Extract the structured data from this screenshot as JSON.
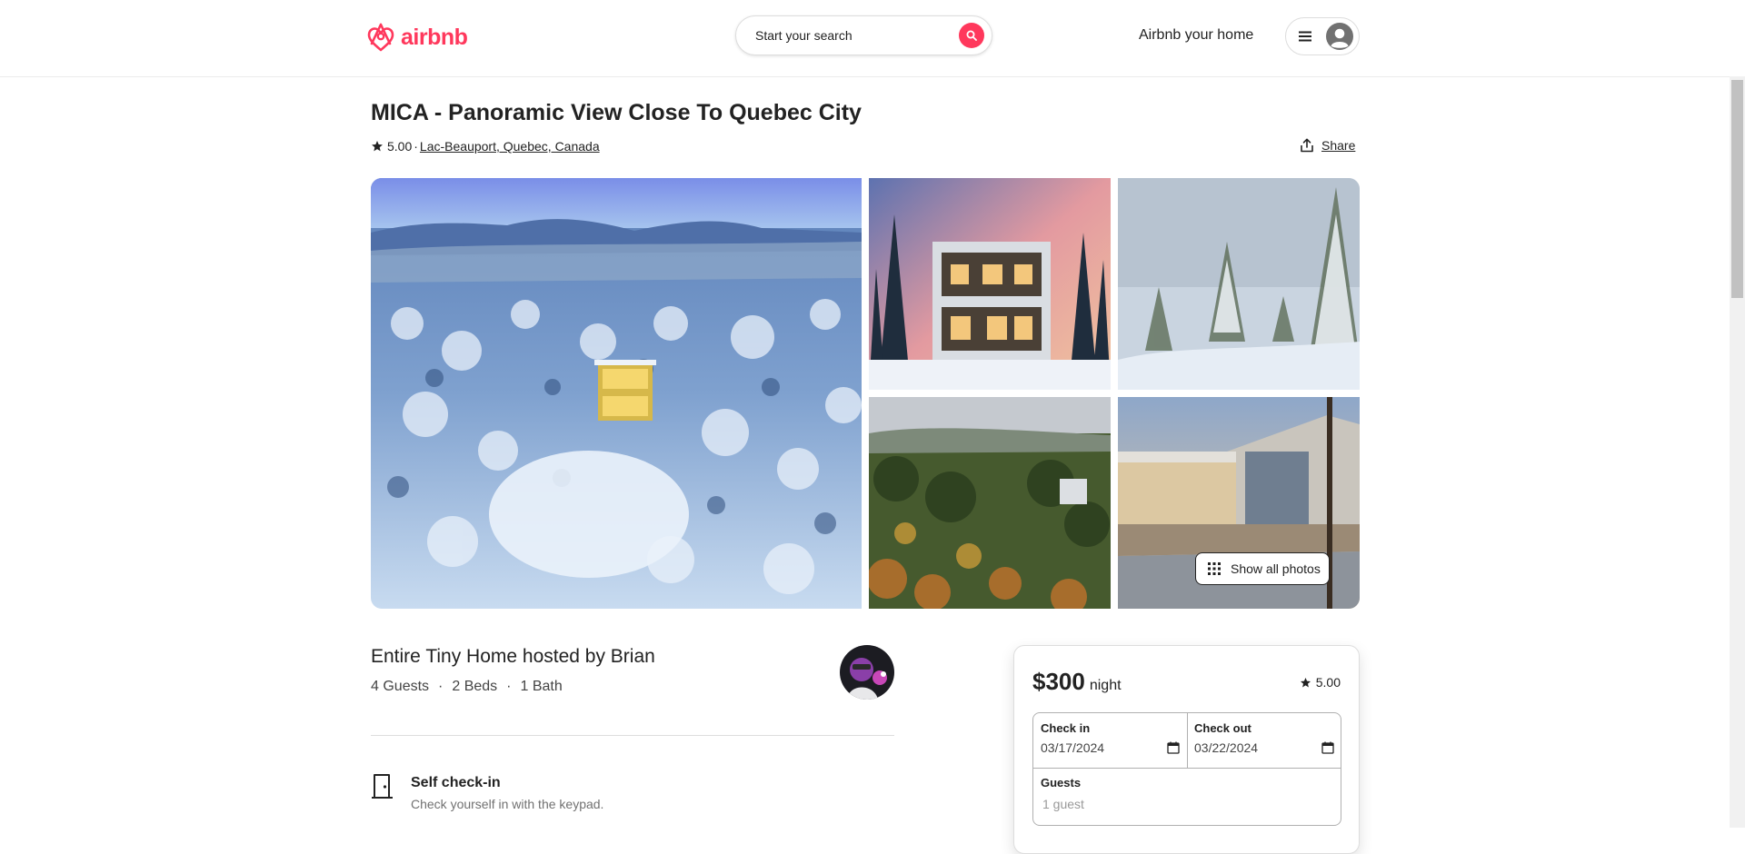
{
  "header": {
    "logo_text": "airbnb",
    "search_placeholder": "Start your search",
    "host_link": "Airbnb your home",
    "icons": [
      "airbnb-logo-icon",
      "search-icon",
      "hamburger-menu-icon",
      "user-avatar-icon"
    ]
  },
  "listing": {
    "title": "MICA - Panoramic View Close To Quebec City",
    "rating": "5.00",
    "separator": "·",
    "location": "Lac-Beauport, Quebec, Canada",
    "share_label": "Share"
  },
  "gallery": {
    "photos": [
      "photo-aerial-winter-forest",
      "photo-house-winter-dusk",
      "photo-snowy-trees",
      "photo-autumn-forest",
      "photo-terrace-view"
    ],
    "show_all_label": "Show all photos"
  },
  "details": {
    "host_title": "Entire Tiny Home hosted by Brian",
    "overview": [
      "4 Guests",
      "2 Beds",
      "1 Bath"
    ],
    "overview_separator": "·",
    "features": [
      {
        "title": "Self check-in",
        "subtitle": "Check yourself in with the keypad.",
        "icon": "door-icon"
      }
    ]
  },
  "booking": {
    "price": "$300",
    "price_unit": "night",
    "rating": "5.00",
    "checkin_label": "Check in",
    "checkin_value": "03/17/2024",
    "checkout_label": "Check out",
    "checkout_value": "03/22/2024",
    "guests_label": "Guests",
    "guests_value": "1 guest"
  },
  "colors": {
    "brand": "#ff385c",
    "text": "#222222",
    "muted": "#717171",
    "border": "#dddddd"
  }
}
